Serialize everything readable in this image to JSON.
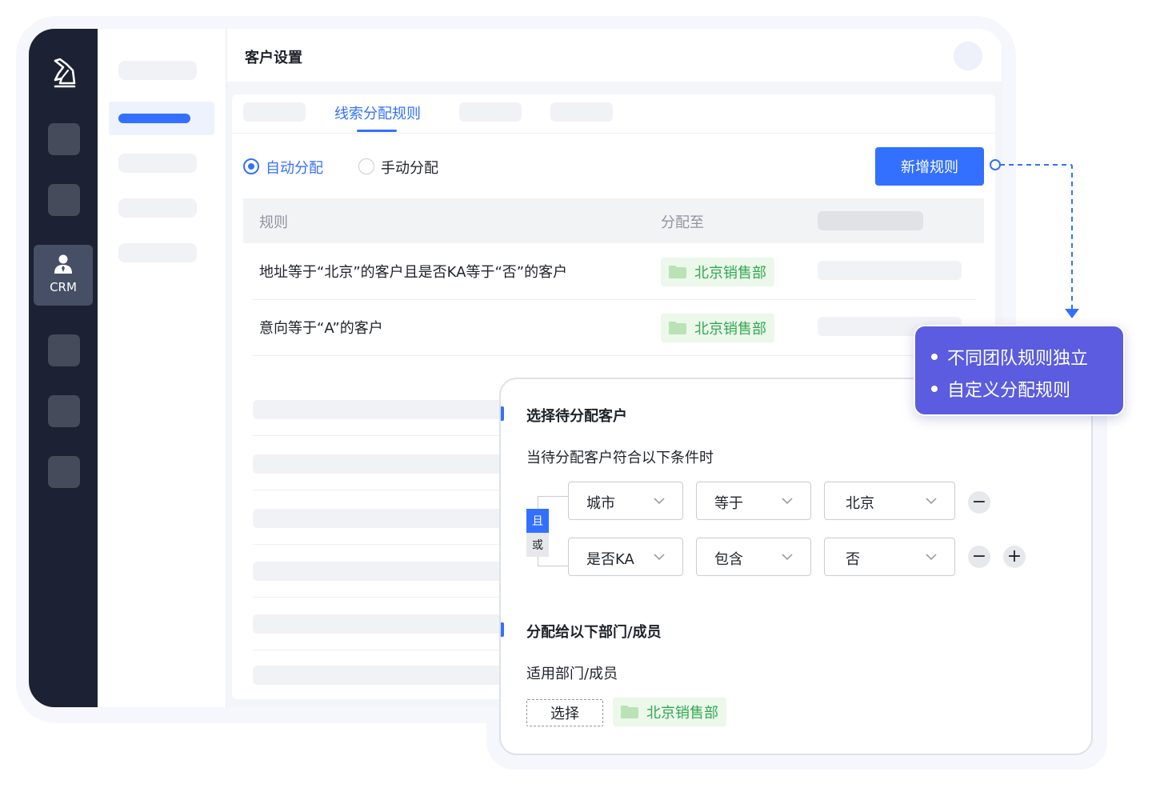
{
  "colors": {
    "accent": "#3370ff",
    "rail": "#1c2233",
    "tag_bg": "#ebf8ea",
    "tag_text": "#34a853",
    "callout": "#5b5ce0"
  },
  "rail": {
    "logo_icon": "horse-logo-icon",
    "active_item": {
      "icon": "user-icon",
      "label": "CRM"
    }
  },
  "header": {
    "title": "客户设置"
  },
  "tabs": {
    "active_label": "线索分配规则"
  },
  "mode": {
    "auto_label": "自动分配",
    "manual_label": "手动分配",
    "selected": "自动分配"
  },
  "toolbar": {
    "add_rule_label": "新增规则"
  },
  "table": {
    "columns": {
      "rule": "规则",
      "assign_to": "分配至"
    },
    "rows": [
      {
        "rule": "地址等于“北京”的客户且是否KA等于“否”的客户",
        "assign_to": "北京销售部"
      },
      {
        "rule": "意向等于“A”的客户",
        "assign_to": "北京销售部"
      }
    ]
  },
  "callout": {
    "items": [
      "不同团队规则独立",
      "自定义分配规则"
    ]
  },
  "editor": {
    "section1_title": "选择待分配客户",
    "condition_hint": "当待分配客户符合以下条件时",
    "logic": {
      "and_label": "且",
      "or_label": "或",
      "selected": "且"
    },
    "conditions": [
      {
        "field": "城市",
        "operator": "等于",
        "value": "北京"
      },
      {
        "field": "是否KA",
        "operator": "包含",
        "value": "否"
      }
    ],
    "remove_label": "−",
    "add_label": "+",
    "section2_title": "分配给以下部门/成员",
    "scope_label": "适用部门/成员",
    "select_button_label": "选择",
    "selected_dept": "北京销售部"
  }
}
